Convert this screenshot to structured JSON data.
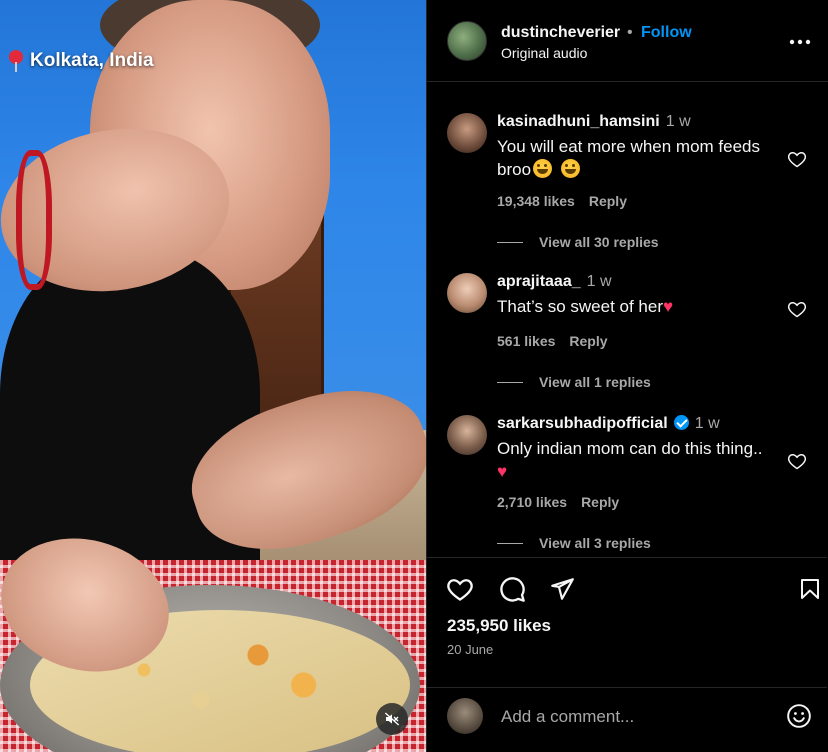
{
  "video": {
    "location": "Kolkata, India",
    "location_icon": "pin-icon",
    "mute_icon": "muted-speaker-icon"
  },
  "header": {
    "username": "dustincheverier",
    "separator": "•",
    "follow_label": "Follow",
    "audio_label": "Original audio",
    "more_icon": "more-options-icon"
  },
  "comments": [
    {
      "username": "kasinadhuni_hamsini",
      "time": "1 w",
      "text": "You will eat more when mom feeds broo",
      "likes": "19,348 likes",
      "reply_label": "Reply",
      "view_replies": "View all 30 replies",
      "verified": false
    },
    {
      "username": "aprajitaaa_",
      "time": "1 w",
      "text": "That’s so sweet of her",
      "likes": "561 likes",
      "reply_label": "Reply",
      "view_replies": "View all 1 replies",
      "verified": false
    },
    {
      "username": "sarkarsubhadipofficial",
      "time": "1 w",
      "text": "Only indian mom can do this thing..",
      "likes": "2,710 likes",
      "reply_label": "Reply",
      "view_replies": "View all 3 replies",
      "verified": true
    }
  ],
  "actions": {
    "like_icon": "heart-icon",
    "comment_icon": "comment-bubble-icon",
    "share_icon": "paper-plane-icon",
    "save_icon": "bookmark-icon",
    "likes_count": "235,950 likes",
    "date": "20 June"
  },
  "comment_box": {
    "placeholder": "Add a comment...",
    "emoji_icon": "smiley-icon"
  },
  "colors": {
    "background": "#000000",
    "text": "#f5f5f5",
    "secondary_text": "#a8a8a8",
    "link_blue": "#0095f6",
    "divider": "#262626"
  }
}
